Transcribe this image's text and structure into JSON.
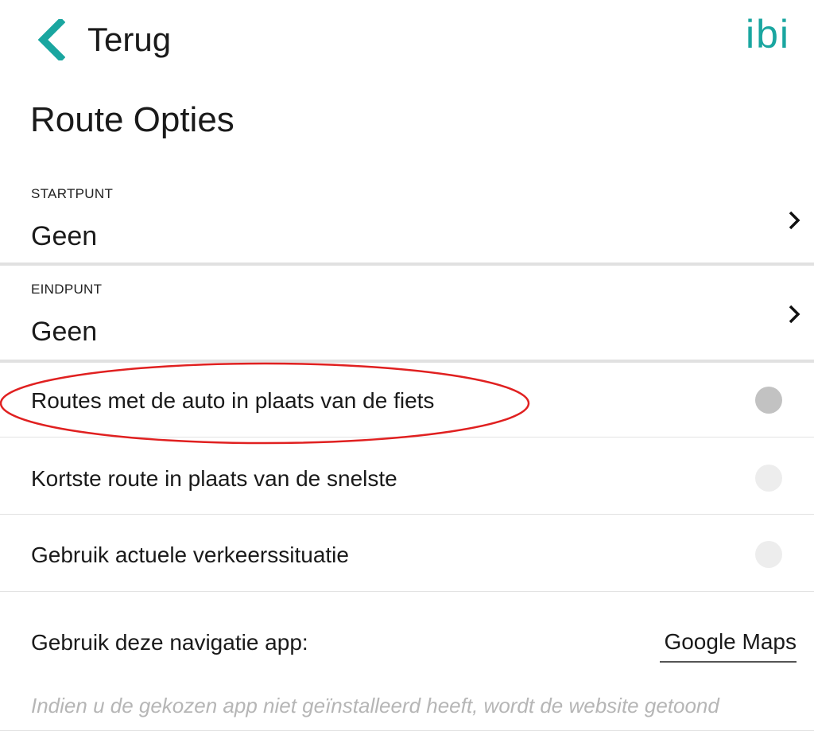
{
  "header": {
    "back_label": "Terug",
    "logo_text": "ibi",
    "accent_color": "#1aa6a0"
  },
  "page_title": "Route Opties",
  "route_points": [
    {
      "caption": "STARTPUNT",
      "value": "Geen"
    },
    {
      "caption": "EINDPUNT",
      "value": "Geen"
    }
  ],
  "toggles": [
    {
      "label": "Routes met de auto in plaats van de fiets",
      "state": "on"
    },
    {
      "label": "Kortste route in plaats van de snelste",
      "state": "off"
    },
    {
      "label": "Gebruik actuele verkeerssituatie",
      "state": "off"
    }
  ],
  "navigation": {
    "label": "Gebruik deze navigatie app:",
    "selected_app": "Google Maps",
    "hint": "Indien u de gekozen app niet geïnstalleerd heeft, wordt de website getoond"
  },
  "annotation_color": "#e02020"
}
